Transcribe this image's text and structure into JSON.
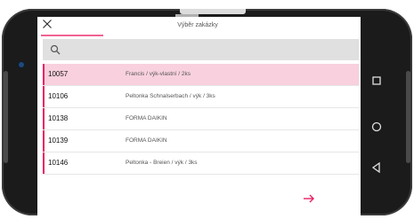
{
  "header": {
    "title": "Výběr zakázky"
  },
  "search": {
    "placeholder": ""
  },
  "orders": [
    {
      "code": "10057",
      "description": "Francis / výk-vlastní / 2ks"
    },
    {
      "code": "10106",
      "description": "Peltonka Schnalserbach / výk / 3ks"
    },
    {
      "code": "10138",
      "description": "FORMA DAIKIN"
    },
    {
      "code": "10139",
      "description": "FORMA DAIKIN"
    },
    {
      "code": "10146",
      "description": "Peltonka - Breien / výk / 3ks"
    }
  ],
  "colors": {
    "accent": "#E91E63",
    "selected_row": "#F8D0DE",
    "search_bg": "#E0E0E0"
  },
  "icons": {
    "close": "close-icon",
    "search": "search-icon",
    "next": "arrow-right-icon",
    "nav_recent": "square-icon",
    "nav_home": "circle-icon",
    "nav_back": "triangle-back-icon"
  }
}
